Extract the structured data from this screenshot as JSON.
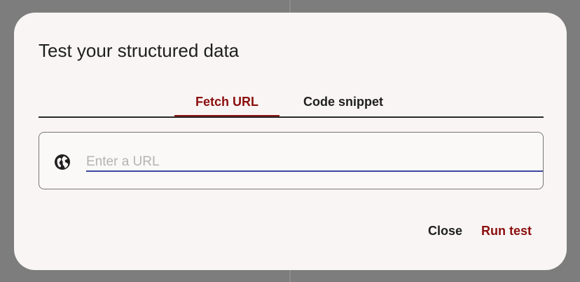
{
  "dialog": {
    "title": "Test your structured data",
    "tabs": [
      {
        "label": "Fetch URL",
        "active": true
      },
      {
        "label": "Code snippet",
        "active": false
      }
    ],
    "url_input": {
      "value": "",
      "placeholder": "Enter a URL",
      "icon": "globe-icon"
    },
    "actions": {
      "close_label": "Close",
      "run_label": "Run test"
    }
  },
  "colors": {
    "accent": "#8b0e0e",
    "input_underline": "#3b4aa1",
    "dialog_bg": "#f8f5f4",
    "backdrop": "#7d7d7d"
  }
}
